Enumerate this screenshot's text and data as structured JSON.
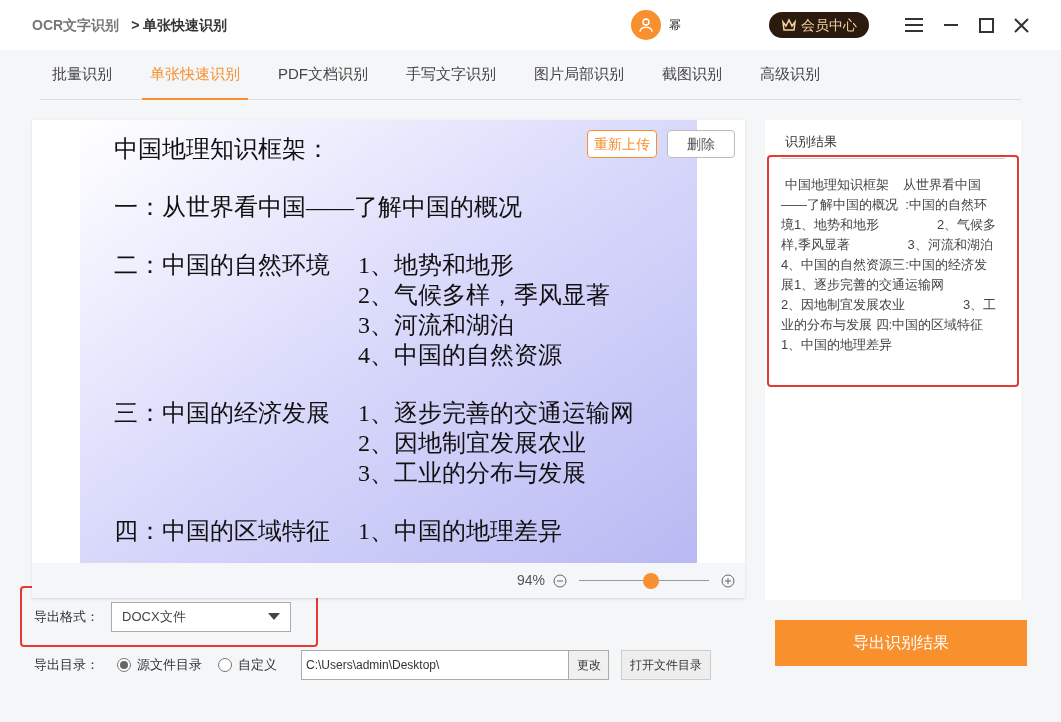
{
  "header": {
    "app_name": "OCR文字识别",
    "breadcrumb": "> 单张快速识别",
    "username": "幂",
    "vip_button": "会员中心"
  },
  "tabs": [
    {
      "label": "批量识别",
      "selected": false
    },
    {
      "label": "单张快速识别",
      "selected": true
    },
    {
      "label": "PDF文档识别",
      "selected": false
    },
    {
      "label": "手写文字识别",
      "selected": false
    },
    {
      "label": "图片局部识别",
      "selected": false
    },
    {
      "label": "截图识别",
      "selected": false
    },
    {
      "label": "高级识别",
      "selected": false
    }
  ],
  "preview": {
    "reupload_button": "重新上传",
    "delete_button": "删除",
    "zoom_reading": "94%",
    "zoom": {
      "level": 0.55
    },
    "slide": {
      "title": "中国地理知识框架：",
      "sections": [
        {
          "heading": "一：从世界看中国——了解中国的概况"
        },
        {
          "heading": "二：中国的自然环境",
          "items": [
            "1、地势和地形",
            "2、气候多样，季风显著",
            "3、河流和湖泊",
            "4、中国的自然资源"
          ]
        },
        {
          "heading": "三：中国的经济发展",
          "items": [
            "1、逐步完善的交通运输网",
            "2、因地制宜发展农业",
            "3、工业的分布与发展"
          ]
        },
        {
          "heading": "四：中国的区域特征",
          "items": [
            "1、中国的地理差异"
          ]
        }
      ]
    }
  },
  "result": {
    "title": "识别结果",
    "text": " 中国地理知识框架    从世界看中国——了解中国的概况  :中国的自然环境1、地势和地形                2、气候多样,季风显著                3、河流和湖泊                4、中国的自然资源三:中国的经济发展1、逐步完善的交通运输网                2、因地制宜发展农业                3、工业的分布与发展 四:中国的区域特征1、中国的地理差异"
  },
  "export_format": {
    "label": "导出格式：",
    "value": "DOCX文件"
  },
  "export_dir": {
    "label": "导出目录：",
    "options": [
      {
        "label": "源文件目录",
        "selected": true
      },
      {
        "label": "自定义",
        "selected": false
      }
    ],
    "path": "C:\\Users\\admin\\Desktop\\",
    "change_button": "更改",
    "open_button": "打开文件目录"
  },
  "export_button": "导出识别结果"
}
